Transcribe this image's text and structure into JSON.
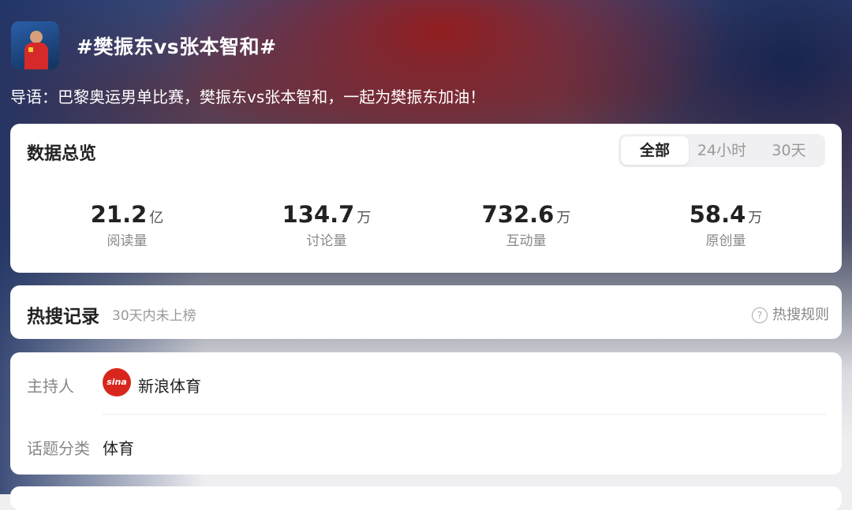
{
  "header": {
    "title": "#樊振东vs张本智和#",
    "intro": "导语：巴黎奥运男单比赛，樊振东vs张本智和，一起为樊振东加油！"
  },
  "overview": {
    "title": "数据总览",
    "tabs": [
      "全部",
      "24小时",
      "30天"
    ],
    "active_tab": "全部",
    "stats": [
      {
        "value": "21.2",
        "unit": "亿",
        "label": "阅读量"
      },
      {
        "value": "134.7",
        "unit": "万",
        "label": "讨论量"
      },
      {
        "value": "732.6",
        "unit": "万",
        "label": "互动量"
      },
      {
        "value": "58.4",
        "unit": "万",
        "label": "原创量"
      }
    ]
  },
  "hot_search": {
    "title": "热搜记录",
    "subtitle": "30天内未上榜",
    "rule_label": "热搜规则"
  },
  "info": {
    "host_label": "主持人",
    "host_name": "新浪体育",
    "host_logo_text": "sina",
    "category_label": "话题分类",
    "category_value": "体育"
  },
  "icons": {
    "avatar": "player-avatar-icon",
    "help": "question-circle-icon",
    "host_logo": "sina-logo-icon"
  },
  "colors": {
    "accent_red": "#d8261c",
    "text_primary": "#222222",
    "text_secondary": "#888888"
  }
}
